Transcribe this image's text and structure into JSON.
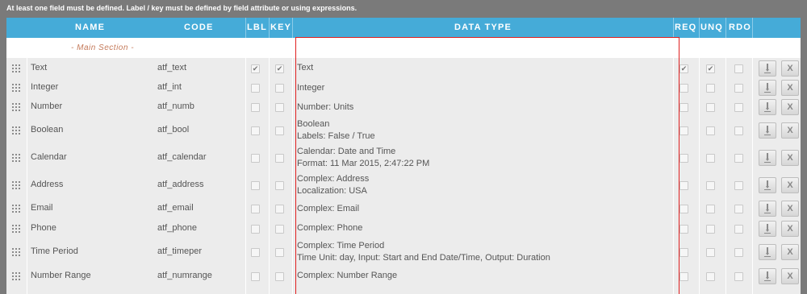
{
  "notice": "At least one field must be defined. Label / key must be defined by field attribute or using expressions.",
  "columns": {
    "name": "NAME",
    "code": "CODE",
    "lbl": "LBL",
    "key": "KEY",
    "data_type": "DATA TYPE",
    "req": "REQ",
    "unq": "UNQ",
    "rdo": "RDO"
  },
  "section_label": "- Main Section -",
  "icons": {
    "drag": "drag-handle-icon",
    "edit": "edit-icon",
    "delete": "delete-x-icon",
    "delete_glyph": "X",
    "check_glyph": "✔"
  },
  "colors": {
    "header_bg": "#45abd8",
    "grid_bg": "#ececec",
    "highlight_border": "#e02020"
  },
  "rows": [
    {
      "name": "Text",
      "code": "atf_text",
      "dt1": "Text",
      "dt2": "",
      "lbl": true,
      "key": true,
      "req": true,
      "unq": true,
      "rdo": false
    },
    {
      "name": "Integer",
      "code": "atf_int",
      "dt1": "Integer",
      "dt2": "",
      "lbl": false,
      "key": false,
      "req": false,
      "unq": false,
      "rdo": false
    },
    {
      "name": "Number",
      "code": "atf_numb",
      "dt1": "Number: Units",
      "dt2": "",
      "lbl": false,
      "key": false,
      "req": false,
      "unq": false,
      "rdo": false
    },
    {
      "name": "Boolean",
      "code": "atf_bool",
      "dt1": "Boolean",
      "dt2": "Labels: False / True",
      "lbl": false,
      "key": false,
      "req": false,
      "unq": false,
      "rdo": false
    },
    {
      "name": "Calendar",
      "code": "atf_calendar",
      "dt1": "Calendar: Date and Time",
      "dt2": "Format: 11 Mar 2015, 2:47:22 PM",
      "lbl": false,
      "key": false,
      "req": false,
      "unq": false,
      "rdo": false
    },
    {
      "name": "Address",
      "code": "atf_address",
      "dt1": "Complex: Address",
      "dt2": "Localization: USA",
      "lbl": false,
      "key": false,
      "req": false,
      "unq": false,
      "rdo": false
    },
    {
      "name": "Email",
      "code": "atf_email",
      "dt1": "Complex: Email",
      "dt2": "",
      "lbl": false,
      "key": false,
      "req": false,
      "unq": false,
      "rdo": false
    },
    {
      "name": "Phone",
      "code": "atf_phone",
      "dt1": "Complex: Phone",
      "dt2": "",
      "lbl": false,
      "key": false,
      "req": false,
      "unq": false,
      "rdo": false
    },
    {
      "name": "Time Period",
      "code": "atf_timeper",
      "dt1": "Complex: Time Period",
      "dt2": "Time Unit: day, Input: Start and End Date/Time, Output: Duration",
      "lbl": false,
      "key": false,
      "req": false,
      "unq": false,
      "rdo": false
    },
    {
      "name": "Number Range",
      "code": "atf_numrange",
      "dt1": "Complex: Number Range",
      "dt2": "",
      "lbl": false,
      "key": false,
      "req": false,
      "unq": false,
      "rdo": false
    }
  ]
}
